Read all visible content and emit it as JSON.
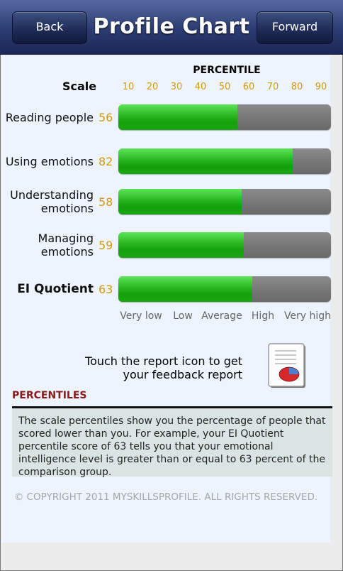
{
  "header": {
    "title": "Profile Chart",
    "back_label": "Back",
    "forward_label": "Forward"
  },
  "chart_data": {
    "type": "bar",
    "title": "PERCENTILE",
    "scale_label": "Scale",
    "orientation": "horizontal",
    "ticks": [
      "10",
      "20",
      "30",
      "40",
      "50",
      "60",
      "70",
      "80",
      "90"
    ],
    "xlim": [
      0,
      100
    ],
    "categories": [
      {
        "lines": [
          "Reading people"
        ],
        "bold": false
      },
      {
        "lines": [
          "Using emotions"
        ],
        "bold": false
      },
      {
        "lines": [
          "Understanding",
          "emotions"
        ],
        "bold": false
      },
      {
        "lines": [
          "Managing",
          "emotions"
        ],
        "bold": false
      },
      {
        "lines": [
          "EI Quotient"
        ],
        "bold": true
      }
    ],
    "values": [
      56,
      82,
      58,
      59,
      63
    ],
    "value_labels": [
      "56",
      "82",
      "58",
      "59",
      "63"
    ],
    "bands": [
      "Very low",
      "Low",
      "Average",
      "High",
      "Very high"
    ],
    "colors": {
      "fill": "#22b01a",
      "track": "#7a7a7a",
      "value_text": "#d49a10"
    }
  },
  "report": {
    "text_line1": "Touch the report icon to get",
    "text_line2": "your feedback report",
    "icon": "report-pie-chart-icon"
  },
  "percentiles": {
    "heading": "PERCENTILES",
    "body": "The scale percentiles show you the percentage of people that scored lower than you. For example, your EI Quotient percentile score of 63 tells you that your emotional intelligence level is greater than or equal to 63 percent of the comparison group."
  },
  "footer": {
    "copyright": "© COPYRIGHT 2011 MYSKILLSPROFILE. ALL RIGHTS RESERVED."
  }
}
